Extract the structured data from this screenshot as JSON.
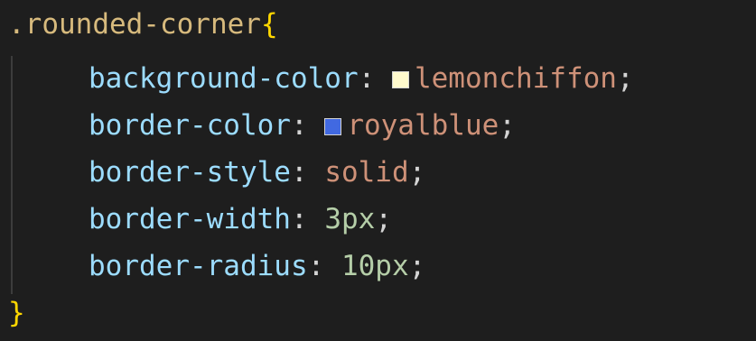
{
  "selector": ".rounded-corner",
  "open_brace": "{",
  "close_brace": "}",
  "colors": {
    "background": "#1e1e1e",
    "selector": "#d7ba7d",
    "brace": "#ffd700",
    "property": "#9cdcfe",
    "string_value": "#ce9178",
    "numeric_value": "#b5cea8",
    "lemonchiffon_swatch": "#fffacd",
    "royalblue_swatch": "#4169e1"
  },
  "declarations": [
    {
      "property": "background-color",
      "colon": ":",
      "value": "lemonchiffon",
      "semicolon": ";"
    },
    {
      "property": "border-color",
      "colon": ":",
      "value": "royalblue",
      "semicolon": ";"
    },
    {
      "property": "border-style",
      "colon": ":",
      "value": "solid",
      "semicolon": ";"
    },
    {
      "property": "border-width",
      "colon": ":",
      "value": "3px",
      "semicolon": ";"
    },
    {
      "property": "border-radius",
      "colon": ":",
      "value": "10px",
      "semicolon": ";"
    }
  ]
}
